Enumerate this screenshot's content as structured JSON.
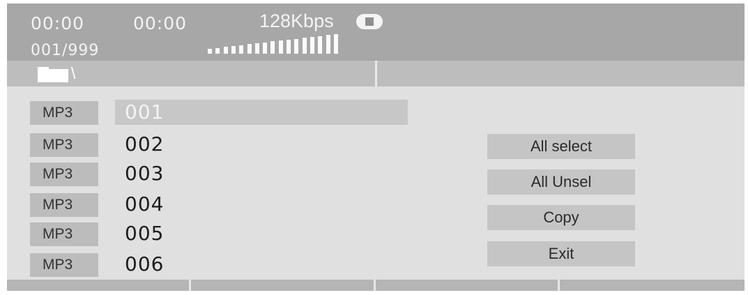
{
  "status": {
    "elapsed_time": "00:00",
    "total_time": "00:00",
    "bitrate": "128Kbps",
    "track_counter": "001/999",
    "level_meter_bars": 17,
    "level_meter_fill": 1.0
  },
  "path": {
    "current": "\\"
  },
  "files": [
    {
      "type": "MP3",
      "name": "001",
      "selected": true
    },
    {
      "type": "MP3",
      "name": "002",
      "selected": false
    },
    {
      "type": "MP3",
      "name": "003",
      "selected": false
    },
    {
      "type": "MP3",
      "name": "004",
      "selected": false
    },
    {
      "type": "MP3",
      "name": "005",
      "selected": false
    },
    {
      "type": "MP3",
      "name": "006",
      "selected": false
    }
  ],
  "actions": {
    "all_select": "All select",
    "all_unsel": "All Unsel",
    "copy": "Copy",
    "exit": "Exit"
  },
  "icons": {
    "folder": "folder-icon",
    "playback_state": "stop-icon"
  },
  "colors": {
    "status_bar": "#a7a7a7",
    "path_bar": "#bdbdbd",
    "panel": "#e0e0e0",
    "highlight": "#c7c7c7"
  }
}
